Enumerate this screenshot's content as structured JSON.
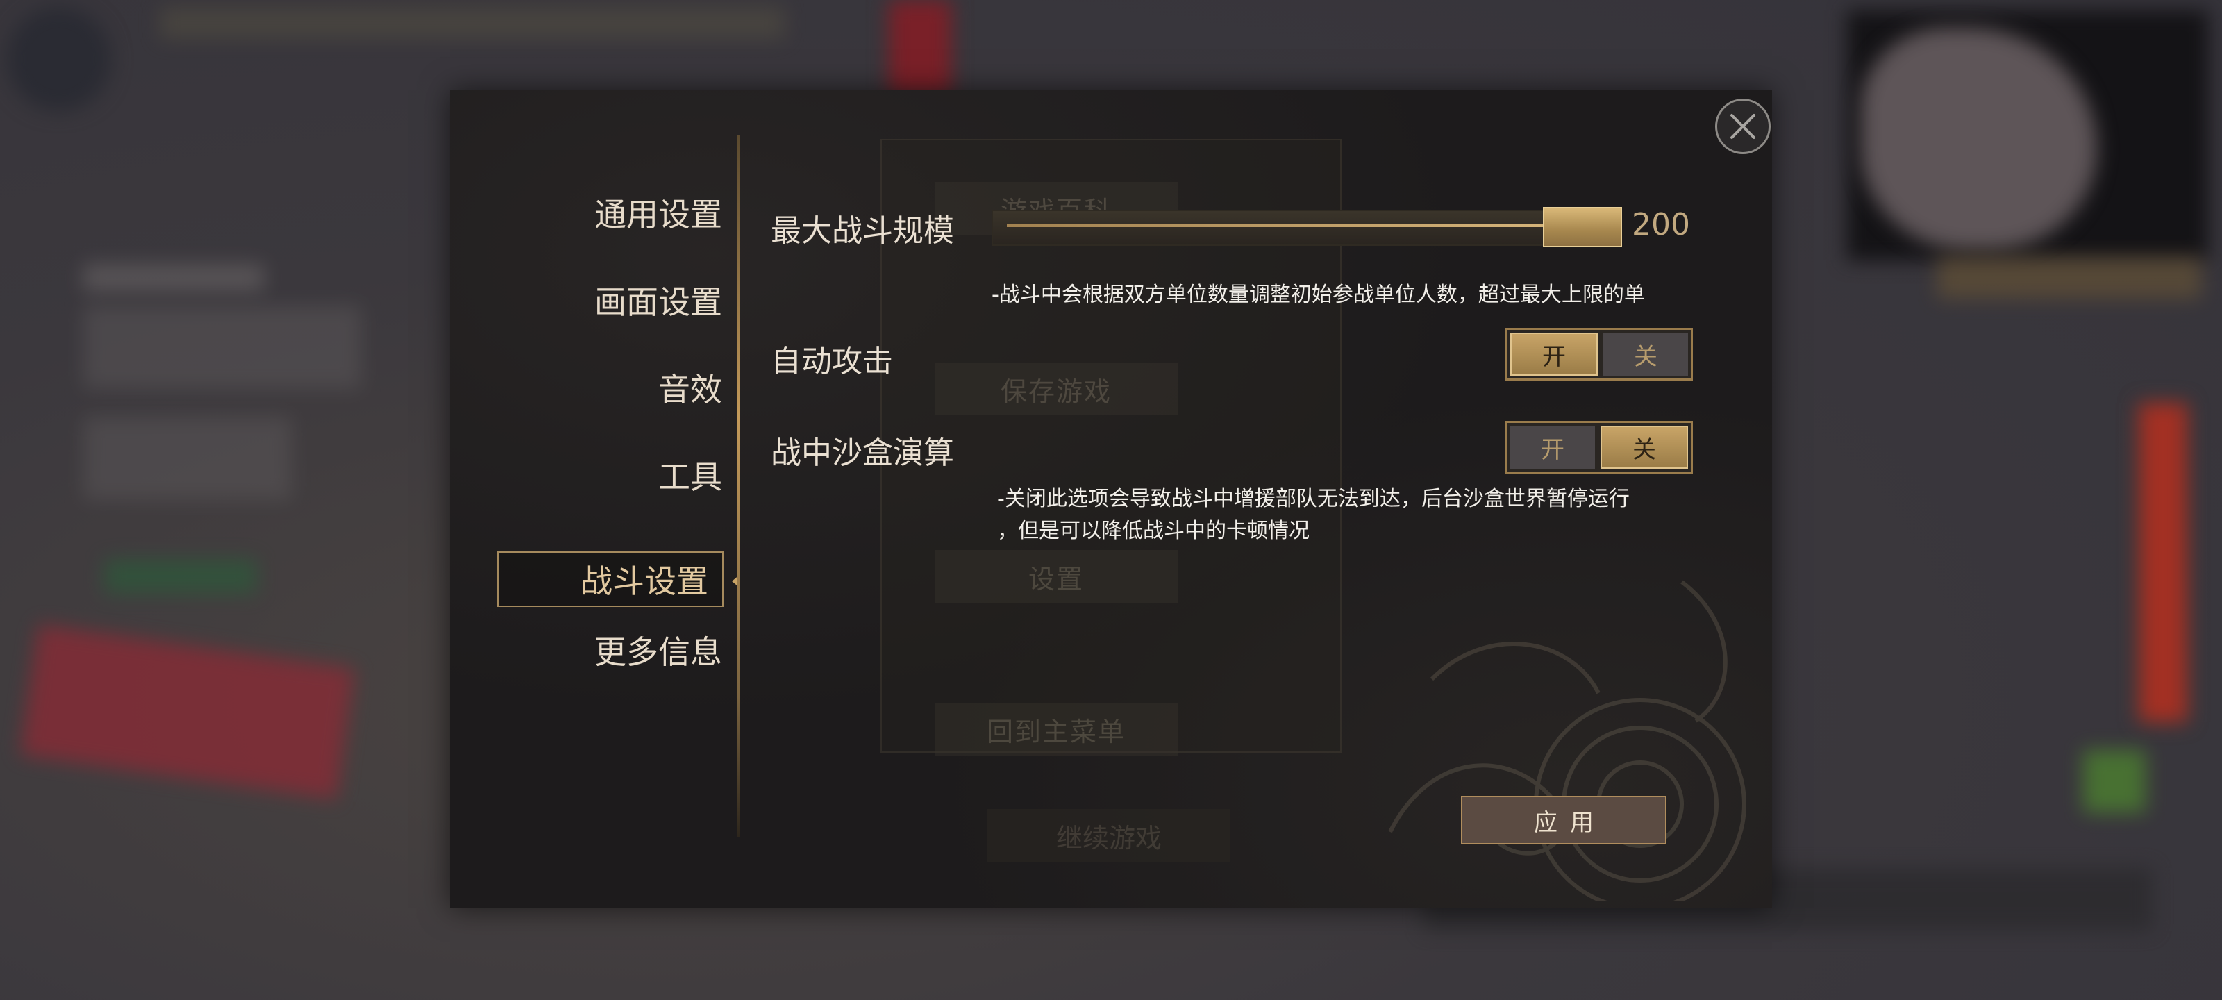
{
  "background": {
    "ghost_menu": [
      "游戏百科",
      "保存游戏",
      "设置",
      "回到主菜单"
    ],
    "ghost_bottom": "继续游戏"
  },
  "sidebar": {
    "items": [
      {
        "label": "通用设置"
      },
      {
        "label": "画面设置"
      },
      {
        "label": "音效"
      },
      {
        "label": "工具"
      },
      {
        "label": "战斗设置",
        "active": true
      },
      {
        "label": "更多信息"
      }
    ]
  },
  "settings": {
    "max_battle": {
      "label": "最大战斗规模",
      "value": "200",
      "fraction": 1.0,
      "note": "-战斗中会根据双方单位数量调整初始参战单位人数，超过最大上限的单"
    },
    "auto_attack": {
      "label": "自动攻击",
      "on_label": "开",
      "off_label": "关",
      "state": "on"
    },
    "sandbox": {
      "label": "战中沙盒演算",
      "on_label": "开",
      "off_label": "关",
      "state": "off",
      "note_line1": "-关闭此选项会导致战斗中增援部队无法到达，后台沙盒世界暂停运行",
      "note_line2": "，但是可以降低战斗中的卡顿情况"
    }
  },
  "buttons": {
    "apply": "应用"
  },
  "colors": {
    "accent_gold": "#c8a467",
    "panel_bg": "#1d1b1c"
  }
}
